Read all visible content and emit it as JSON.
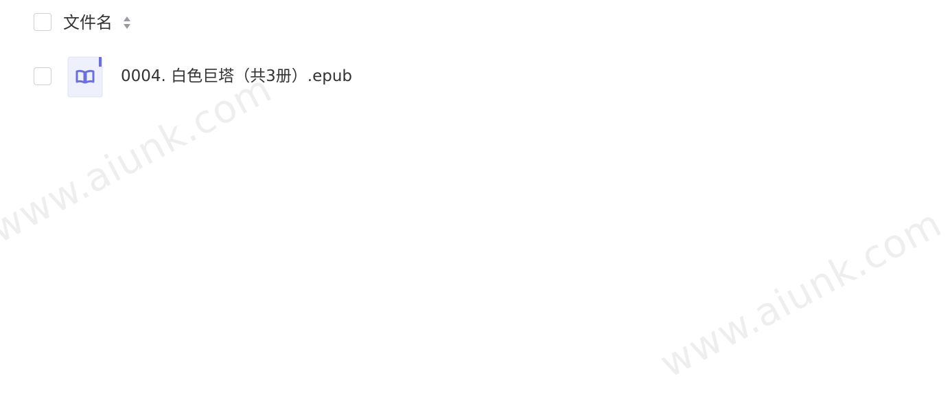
{
  "table": {
    "header": {
      "column_label": "文件名",
      "sort_icon": "sort-both-icon"
    },
    "rows": [
      {
        "name": "0004. 白色巨塔（共3册）.epub",
        "icon": "epub-book-icon",
        "icon_color": "#6c6ee0",
        "icon_bg": "#eef0fc"
      }
    ]
  },
  "watermarks": [
    "www.aiunk.com",
    "www.aiunk.com"
  ]
}
